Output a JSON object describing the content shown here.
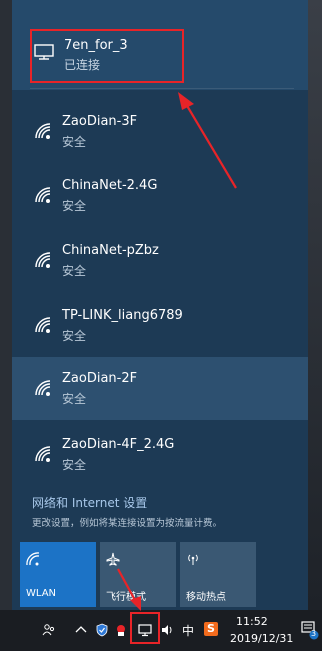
{
  "connected_network": {
    "name": "7en_for_3",
    "status": "已连接"
  },
  "networks": [
    {
      "name": "ZaoDian-3F",
      "security": "安全"
    },
    {
      "name": "ChinaNet-2.4G",
      "security": "安全"
    },
    {
      "name": "ChinaNet-pZbz",
      "security": "安全"
    },
    {
      "name": "TP-LINK_liang6789",
      "security": "安全"
    },
    {
      "name": "ZaoDian-2F",
      "security": "安全"
    },
    {
      "name": "ZaoDian-4F_2.4G",
      "security": "安全"
    }
  ],
  "settings": {
    "link": "网络和 Internet 设置",
    "description": "更改设置，例如将某连接设置为按流量计费。"
  },
  "quick_actions": {
    "wlan": "WLAN",
    "airplane": "飞行模式",
    "hotspot": "移动热点"
  },
  "taskbar": {
    "ime": "中",
    "sogou": "S",
    "time": "11:52",
    "date": "2019/12/31",
    "notification_count": "3"
  },
  "colors": {
    "accent": "#1c73c6",
    "annotation_red": "#e82428",
    "flyout_bg": "#1d3a55"
  }
}
